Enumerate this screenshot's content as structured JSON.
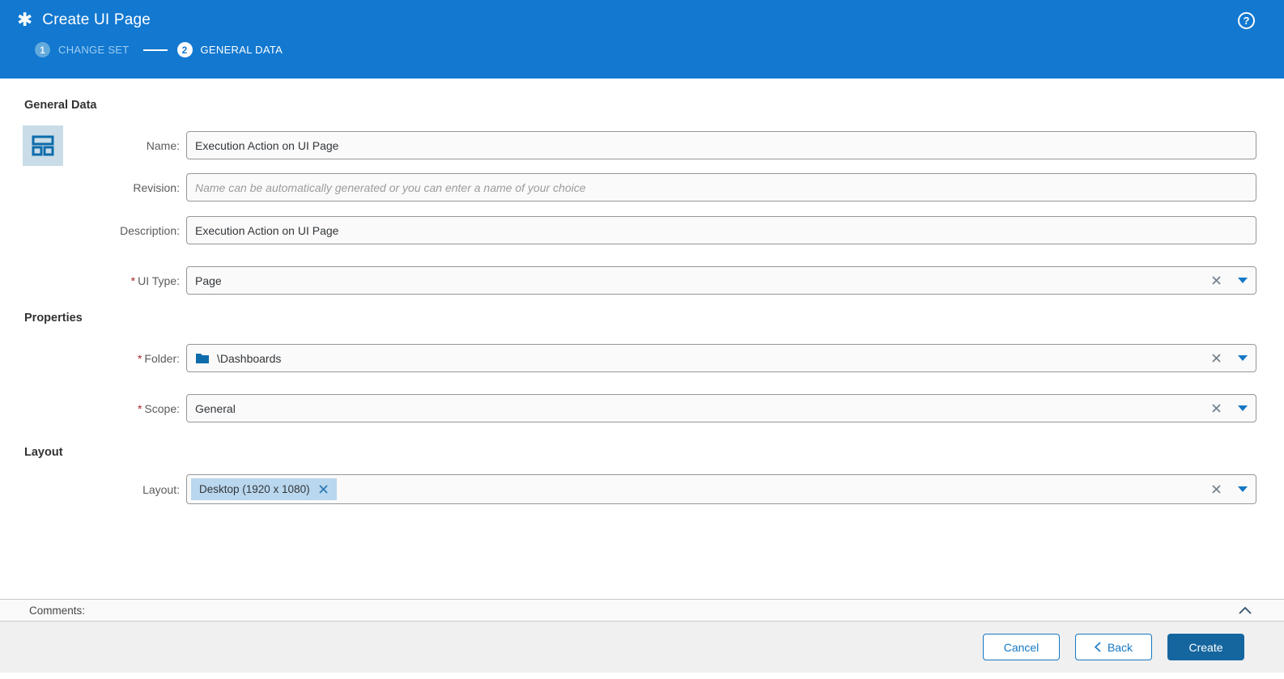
{
  "header": {
    "title": "Create UI Page",
    "help_glyph": "?",
    "steps": [
      {
        "number": "1",
        "label": "CHANGE SET",
        "state": "done"
      },
      {
        "number": "2",
        "label": "GENERAL DATA",
        "state": "active"
      }
    ]
  },
  "sections": {
    "general_heading": "General Data",
    "properties_heading": "Properties",
    "layout_heading": "Layout"
  },
  "required_marker": "*",
  "fields": {
    "name": {
      "label": "Name:",
      "value": "Execution Action on UI Page"
    },
    "revision": {
      "label": "Revision:",
      "value": "",
      "placeholder": "Name can be automatically generated or you can enter a name of your choice"
    },
    "description": {
      "label": "Description:",
      "value": "Execution Action on UI Page"
    },
    "ui_type": {
      "label": "UI Type:",
      "value": "Page",
      "required": true
    },
    "folder": {
      "label": "Folder:",
      "value": "\\Dashboards",
      "required": true
    },
    "scope": {
      "label": "Scope:",
      "value": "General",
      "required": true
    },
    "layout": {
      "label": "Layout:",
      "chip": "Desktop (1920 x 1080)"
    }
  },
  "comments": {
    "label": "Comments:"
  },
  "footer": {
    "cancel_label": "Cancel",
    "back_label": "Back",
    "create_label": "Create"
  },
  "colors": {
    "header_blue": "#1278d0",
    "primary_button_blue": "#15669f",
    "accent_blue": "#1577c4",
    "chip_background": "#b9d7ee",
    "required_red": "#a9272b",
    "icon_background": "#c9dce8"
  }
}
